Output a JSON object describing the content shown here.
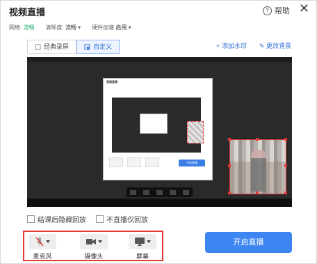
{
  "window": {
    "title": "视频直播",
    "help_label": "帮助",
    "close_symbol": "✕"
  },
  "status": {
    "network_label": "网络:",
    "network_value": "流畅",
    "resolution_label": "清晰度:",
    "resolution_value": "流畅",
    "hw_label": "硬件加速",
    "hw_value": "启用"
  },
  "tabs": [
    {
      "label": "经典录屏",
      "active": false
    },
    {
      "label": "自定义",
      "active": true
    }
  ],
  "actions": {
    "add_watermark": "+ 添加水印",
    "change_bg": "更改背景"
  },
  "preview": {
    "mini_title": "视频直播",
    "mini_start_label": "开启直播"
  },
  "checkboxes": [
    {
      "label": "结课后隐藏回放",
      "checked": false
    },
    {
      "label": "不直播仅回放",
      "checked": false
    }
  ],
  "devices": [
    {
      "label": "麦克风",
      "icon": "mic-off-icon"
    },
    {
      "label": "摄像头",
      "icon": "camera-icon"
    },
    {
      "label": "屏幕",
      "icon": "screen-icon"
    }
  ],
  "start_button": "开启直播",
  "colors": {
    "accent": "#3d86f2",
    "highlight": "#e53935",
    "good": "#1fb36b"
  }
}
